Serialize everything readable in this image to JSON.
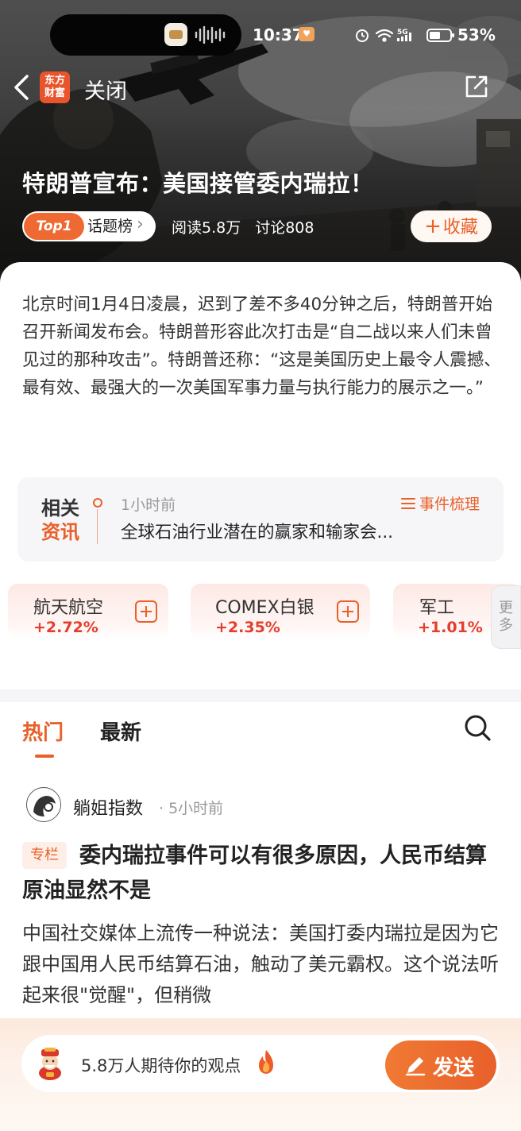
{
  "status_bar": {
    "time": "10:37",
    "battery": "53%",
    "network": "5G"
  },
  "nav": {
    "logo_line1": "东方",
    "logo_line2": "财富",
    "close_label": "关闭"
  },
  "topic": {
    "title": "特朗普宣布：美国接管委内瑞拉！",
    "rank_label": "Top1",
    "board_label": "话题榜",
    "reads": "阅读5.8万",
    "discussions": "讨论808",
    "favorite_label": "收藏"
  },
  "intro": {
    "text": "北京时间1月4日凌晨，迟到了差不多40分钟之后，特朗普开始召开新闻发布会。特朗普形容此次打击是“自二战以来人们未曾见过的那种攻击”。特朗普还称：“这是美国历史上最令人震撼、最有效、最强大的一次美国军事力量与执行能力的展示之一。”"
  },
  "related_news": {
    "tag_line1": "相关",
    "tag_line2": "资讯",
    "time": "1小时前",
    "event_label": "事件梳理",
    "headline": "全球石油行业潜在的赢家和输家会..."
  },
  "stocks": [
    {
      "name": "航天航空",
      "change": "+2.72%"
    },
    {
      "name": "COMEX白银",
      "change": "+2.35%"
    },
    {
      "name": "军工",
      "change": "+1.01%"
    }
  ],
  "more_label_1": "更",
  "more_label_2": "多",
  "feed_tabs": {
    "hot": "热门",
    "latest": "最新"
  },
  "post": {
    "author": "躺姐指数",
    "time": "· 5小时前",
    "badge": "专栏",
    "title": "委内瑞拉事件可以有很多原因，人民币结算原油显然不是",
    "body": "中国社交媒体上流传一种说法：美国打委内瑞拉是因为它跟中国用人民币结算石油，触动了美元霸权。这个说法听起来很\"觉醒\"，但稍微"
  },
  "comment_bar": {
    "prompt": "5.8万人期待你的观点",
    "send_label": "发送"
  },
  "colors": {
    "accent": "#e8602a",
    "up": "#e33e2d"
  }
}
